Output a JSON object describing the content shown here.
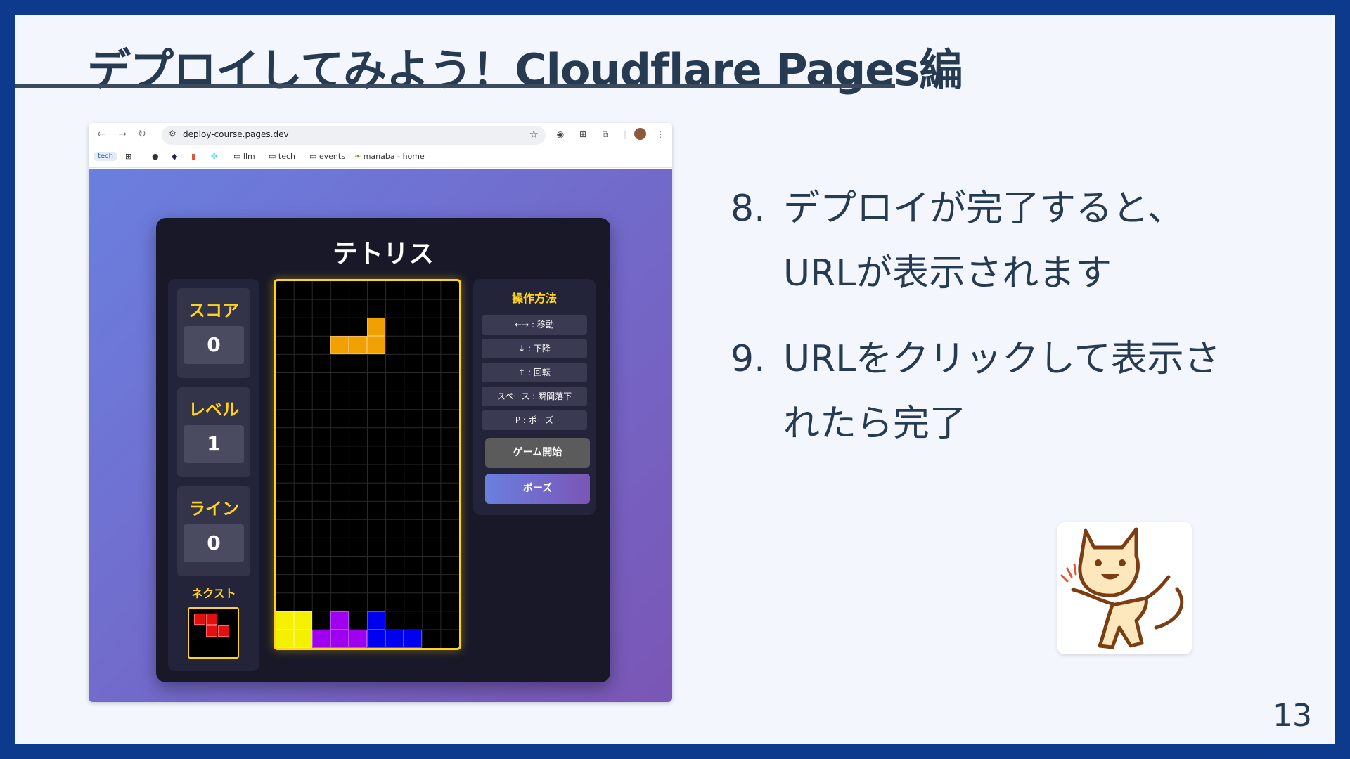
{
  "slide": {
    "title": "デプロイしてみよう！Cloudflare Pages編",
    "page_number": "13",
    "steps": [
      {
        "num": "8.",
        "lines": [
          "デプロイが完了すると、",
          "URLが表示されます"
        ]
      },
      {
        "num": "9.",
        "lines": [
          "URLをクリックして表示さ",
          "れたら完了"
        ]
      }
    ]
  },
  "browser": {
    "url": "deploy-course.pages.dev",
    "bookmarks": [
      "tech",
      "llm",
      "tech",
      "events",
      "manaba - home"
    ]
  },
  "game": {
    "title": "テトリス",
    "stats": [
      {
        "label": "スコア",
        "value": "0"
      },
      {
        "label": "レベル",
        "value": "1"
      },
      {
        "label": "ライン",
        "value": "0"
      }
    ],
    "next_label": "ネクスト",
    "controls_title": "操作方法",
    "controls": [
      "←→ : 移動",
      "↓ : 下降",
      "↑ : 回転",
      "スペース : 瞬間落下",
      "P : ポーズ"
    ],
    "start_button": "ゲーム開始",
    "pause_button": "ポーズ",
    "colors": {
      "accent": "#ffd21e",
      "background": "#181828"
    }
  }
}
